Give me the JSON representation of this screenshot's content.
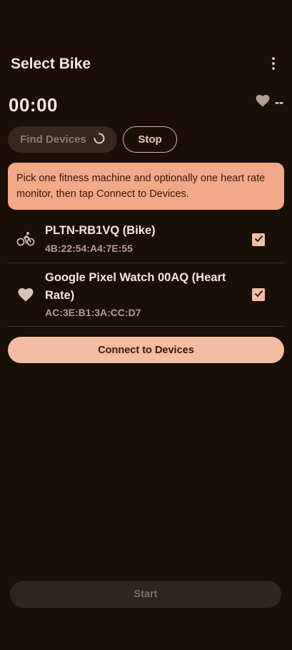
{
  "app_bar": {
    "title": "Select Bike",
    "menu_icon": "more-vertical-icon"
  },
  "status": {
    "timer": "00:00",
    "heart_rate_icon": "heart-icon",
    "heart_rate_value": "--"
  },
  "actions": {
    "find_label": "Find Devices",
    "find_spinner_icon": "loading-spinner-icon",
    "stop_label": "Stop"
  },
  "info": {
    "text": "Pick one fitness machine and optionally one heart rate monitor, then tap Connect to Devices."
  },
  "devices": [
    {
      "icon": "bike-icon",
      "name": "PLTN-RB1VQ (Bike)",
      "address": "4B:22:54:A4:7E:55",
      "checked": true
    },
    {
      "icon": "heart-icon",
      "name": "Google Pixel Watch 00AQ (Heart Rate)",
      "address": "AC:3E:B1:3A:CC:D7",
      "checked": true
    }
  ],
  "connect_label": "Connect to Devices",
  "start_label": "Start",
  "colors": {
    "background": "#1a0e08",
    "accent": "#f4bca2",
    "info_card": "#f1a987"
  }
}
